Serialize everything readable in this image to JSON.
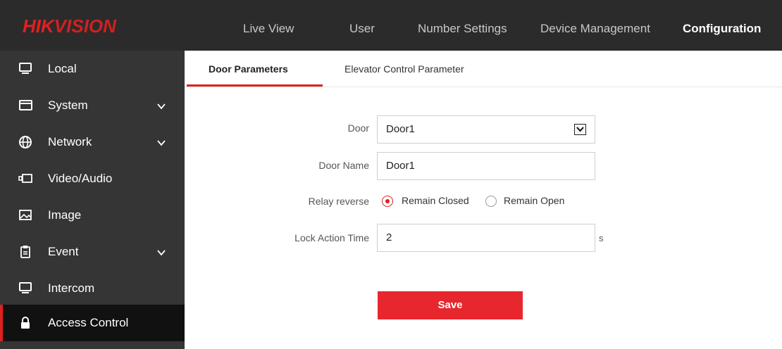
{
  "brand": {
    "part1": "HIK",
    "part2": "VISION"
  },
  "nav": [
    {
      "label": "Live View"
    },
    {
      "label": "User"
    },
    {
      "label": "Number Settings"
    },
    {
      "label": "Device Management"
    },
    {
      "label": "Configuration"
    }
  ],
  "sidebar": {
    "items": [
      {
        "label": "Local",
        "icon": "monitor-icon"
      },
      {
        "label": "System",
        "icon": "system-icon",
        "expandable": true
      },
      {
        "label": "Network",
        "icon": "globe-icon",
        "expandable": true
      },
      {
        "label": "Video/Audio",
        "icon": "video-icon"
      },
      {
        "label": "Image",
        "icon": "image-icon"
      },
      {
        "label": "Event",
        "icon": "clipboard-icon",
        "expandable": true
      },
      {
        "label": "Intercom",
        "icon": "monitor-icon"
      },
      {
        "label": "Access Control",
        "icon": "lock-icon",
        "active": true
      }
    ]
  },
  "tabs": [
    {
      "label": "Door Parameters",
      "active": true
    },
    {
      "label": "Elevator Control Parameter"
    }
  ],
  "form": {
    "door": {
      "label": "Door",
      "value": "Door1"
    },
    "door_name": {
      "label": "Door Name",
      "value": "Door1"
    },
    "relay_reverse": {
      "label": "Relay reverse",
      "options": [
        "Remain Closed",
        "Remain Open"
      ],
      "selected": "Remain Closed"
    },
    "lock_action_time": {
      "label": "Lock Action Time",
      "value": "2",
      "unit": "s"
    }
  },
  "save_label": "Save",
  "colors": {
    "accent": "#e02020",
    "topbar": "#2b2b2b",
    "sidebar": "#353535",
    "sidebar_active": "#111111"
  }
}
